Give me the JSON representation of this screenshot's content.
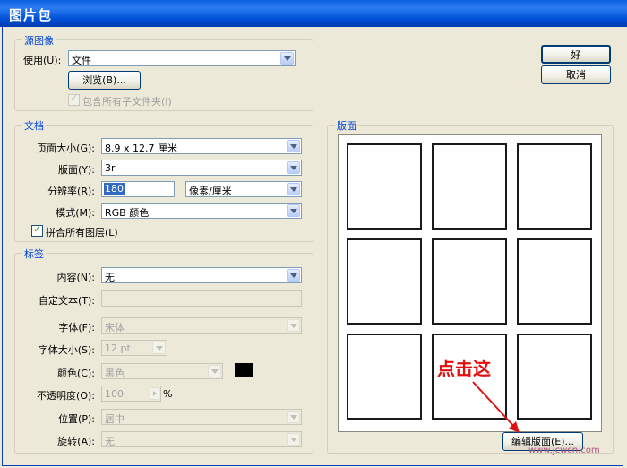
{
  "window": {
    "title": "图片包"
  },
  "buttons": {
    "ok": "好",
    "cancel": "取消"
  },
  "source": {
    "legend": "源图像",
    "use_label": "使用(U):",
    "use_value": "文件",
    "browse": "浏览(B)...",
    "include_subfolders": "包含所有子文件夹(I)"
  },
  "document": {
    "legend": "文档",
    "page_size_label": "页面大小(G):",
    "page_size_value": "8.9 x 12.7 厘米",
    "layout_label": "版面(Y):",
    "layout_value": "3r",
    "resolution_label": "分辨率(R):",
    "resolution_value": "180",
    "resolution_unit": "像素/厘米",
    "mode_label": "模式(M):",
    "mode_value": "RGB 颜色",
    "flatten": "拼合所有图层(L)"
  },
  "label": {
    "legend": "标签",
    "content_label": "内容(N):",
    "content_value": "无",
    "custom_text_label": "自定文本(T):",
    "font_label": "字体(F):",
    "font_value": "宋体",
    "font_size_label": "字体大小(S):",
    "font_size_value": "12 pt",
    "color_label": "颜色(C):",
    "color_value": "黑色",
    "swatch_color": "#000000",
    "opacity_label": "不透明度(O):",
    "opacity_value": "100",
    "opacity_unit": "%",
    "position_label": "位置(P):",
    "position_value": "居中",
    "rotate_label": "旋转(A):",
    "rotate_value": "无"
  },
  "layout_preview": {
    "legend": "版面",
    "rows": 3,
    "cols": 3,
    "edit_layout": "编辑版面(E)..."
  },
  "annotation": {
    "text": "点击这",
    "color": "#e01010"
  },
  "watermark": {
    "text": "www.jcwcn.com"
  }
}
